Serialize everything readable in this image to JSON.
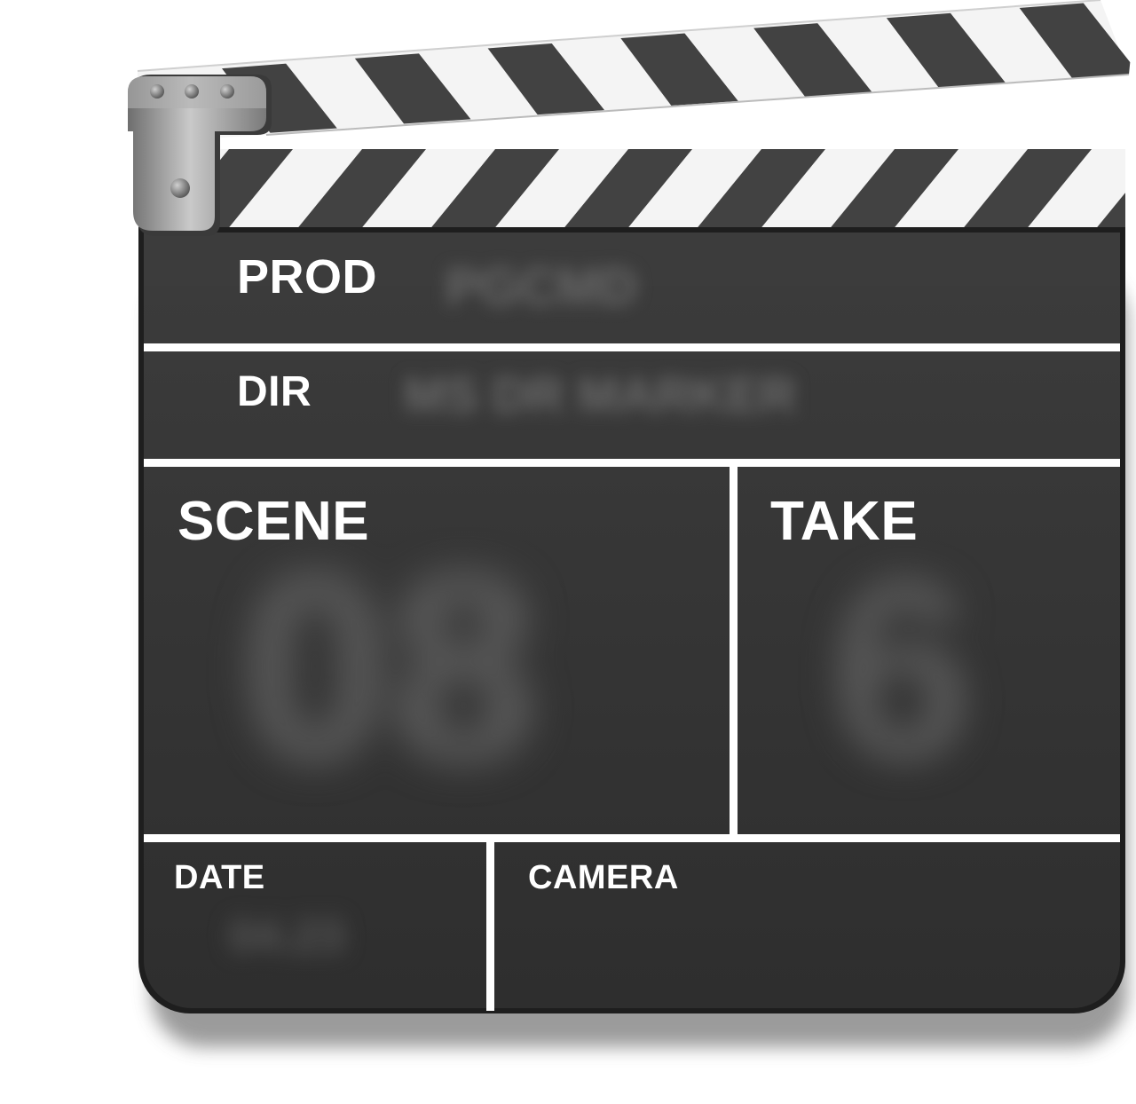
{
  "slate": {
    "prod_label": "PROD",
    "prod_value": "PGCMD",
    "dir_label": "DIR",
    "dir_value": "MS DR MARKER",
    "scene_label": "SCENE",
    "scene_value": "08",
    "take_label": "TAKE",
    "take_value": "6",
    "date_label": "DATE",
    "date_value": "04.23",
    "camera_label": "CAMERA",
    "camera_value": ""
  },
  "colors": {
    "board": "#353535",
    "board_edge": "#1a1a1a",
    "divider": "#ffffff",
    "stripe_dark": "#424242",
    "stripe_light": "#f2f2f2",
    "hinge": "#9a9a9a",
    "text": "#ffffff"
  }
}
